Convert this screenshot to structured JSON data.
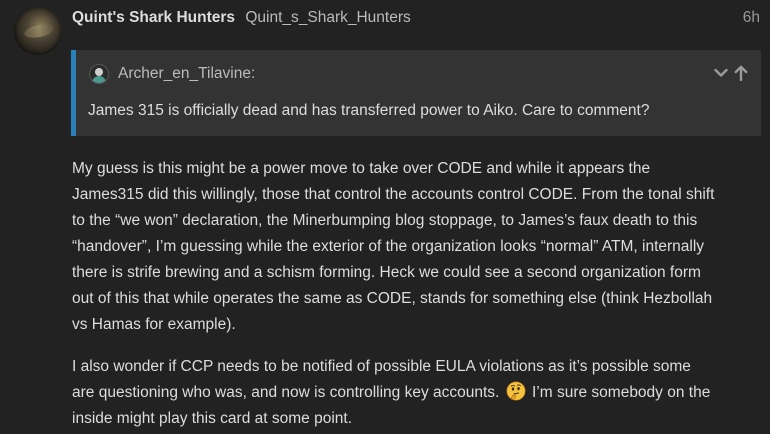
{
  "post": {
    "author_name": "Quint's Shark Hunters",
    "author_username": "Quint_s_Shark_Hunters",
    "date": "6h"
  },
  "quote": {
    "username": "Archer_en_Tilavine:",
    "text": "James 315 is officially dead and has transferred power to Aiko. Care to comment?",
    "controls": [
      "chevron-down-icon",
      "arrow-up-icon"
    ]
  },
  "body": {
    "paragraph1": [
      "My guess is this might be a power move to take over CODE and while it appears the",
      "James315 did this willingly, those that control the accounts control CODE. From the tonal shift",
      "to the “we won” declaration, the Minerbumping blog stoppage, to James’s faux death to this",
      "“handover”, I’m guessing while the exterior of the organization looks “normal” ATM, internally",
      "there is strife brewing and a schism forming. Heck we could see a second organization form",
      "out of this that while operates the same as CODE, stands for something else (think Hezbollah",
      "vs Hamas for example)."
    ],
    "paragraph2": {
      "line1": "I also wonder if CCP needs to be notified of possible EULA violations as it’s possible some",
      "line2_before": "are questioning who was, and now is controlling key accounts.",
      "line2_emoji": "thinking-face-icon",
      "line2_after": "I’m sure somebody on the",
      "line3": "inside might play this card at some point."
    }
  },
  "colors": {
    "background": "#222222",
    "quote_background": "#333333",
    "quote_border": "#2a80b9",
    "text": "#dddddd",
    "muted": "#999999"
  }
}
